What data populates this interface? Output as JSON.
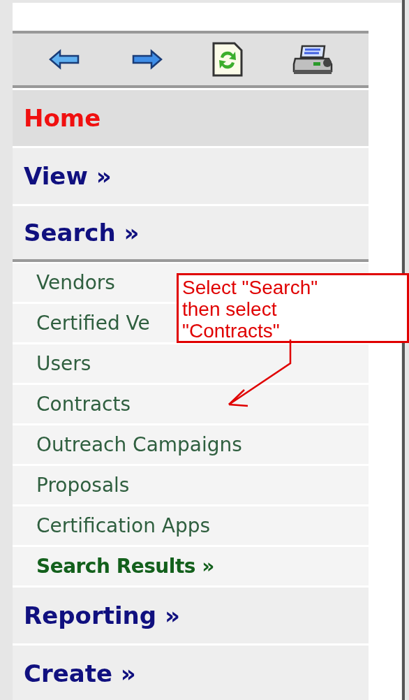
{
  "toolbar": {
    "buttons": [
      {
        "kind": "back"
      },
      {
        "kind": "forward"
      },
      {
        "kind": "refresh"
      },
      {
        "kind": "print"
      }
    ]
  },
  "menu": {
    "items": [
      {
        "kind": "home",
        "label": "Home",
        "expanded": false
      },
      {
        "kind": "section",
        "label": "View »",
        "expanded": false
      },
      {
        "kind": "section",
        "label": "Search »",
        "expanded": true,
        "children": [
          {
            "kind": "link",
            "label": "Vendors"
          },
          {
            "kind": "link",
            "label": "Certified Ve"
          },
          {
            "kind": "link",
            "label": "Users"
          },
          {
            "kind": "link",
            "label": "Contracts"
          },
          {
            "kind": "link",
            "label": "Outreach Campaigns"
          },
          {
            "kind": "link",
            "label": "Proposals"
          },
          {
            "kind": "link",
            "label": "Certification Apps"
          },
          {
            "kind": "strong_link",
            "label": "Search Results »"
          }
        ]
      },
      {
        "kind": "section",
        "label": "Reporting »",
        "expanded": false
      },
      {
        "kind": "section",
        "label": "Create »",
        "expanded": false
      }
    ]
  },
  "callout": {
    "text": "Select \"Search\" then select \"Contracts\""
  }
}
